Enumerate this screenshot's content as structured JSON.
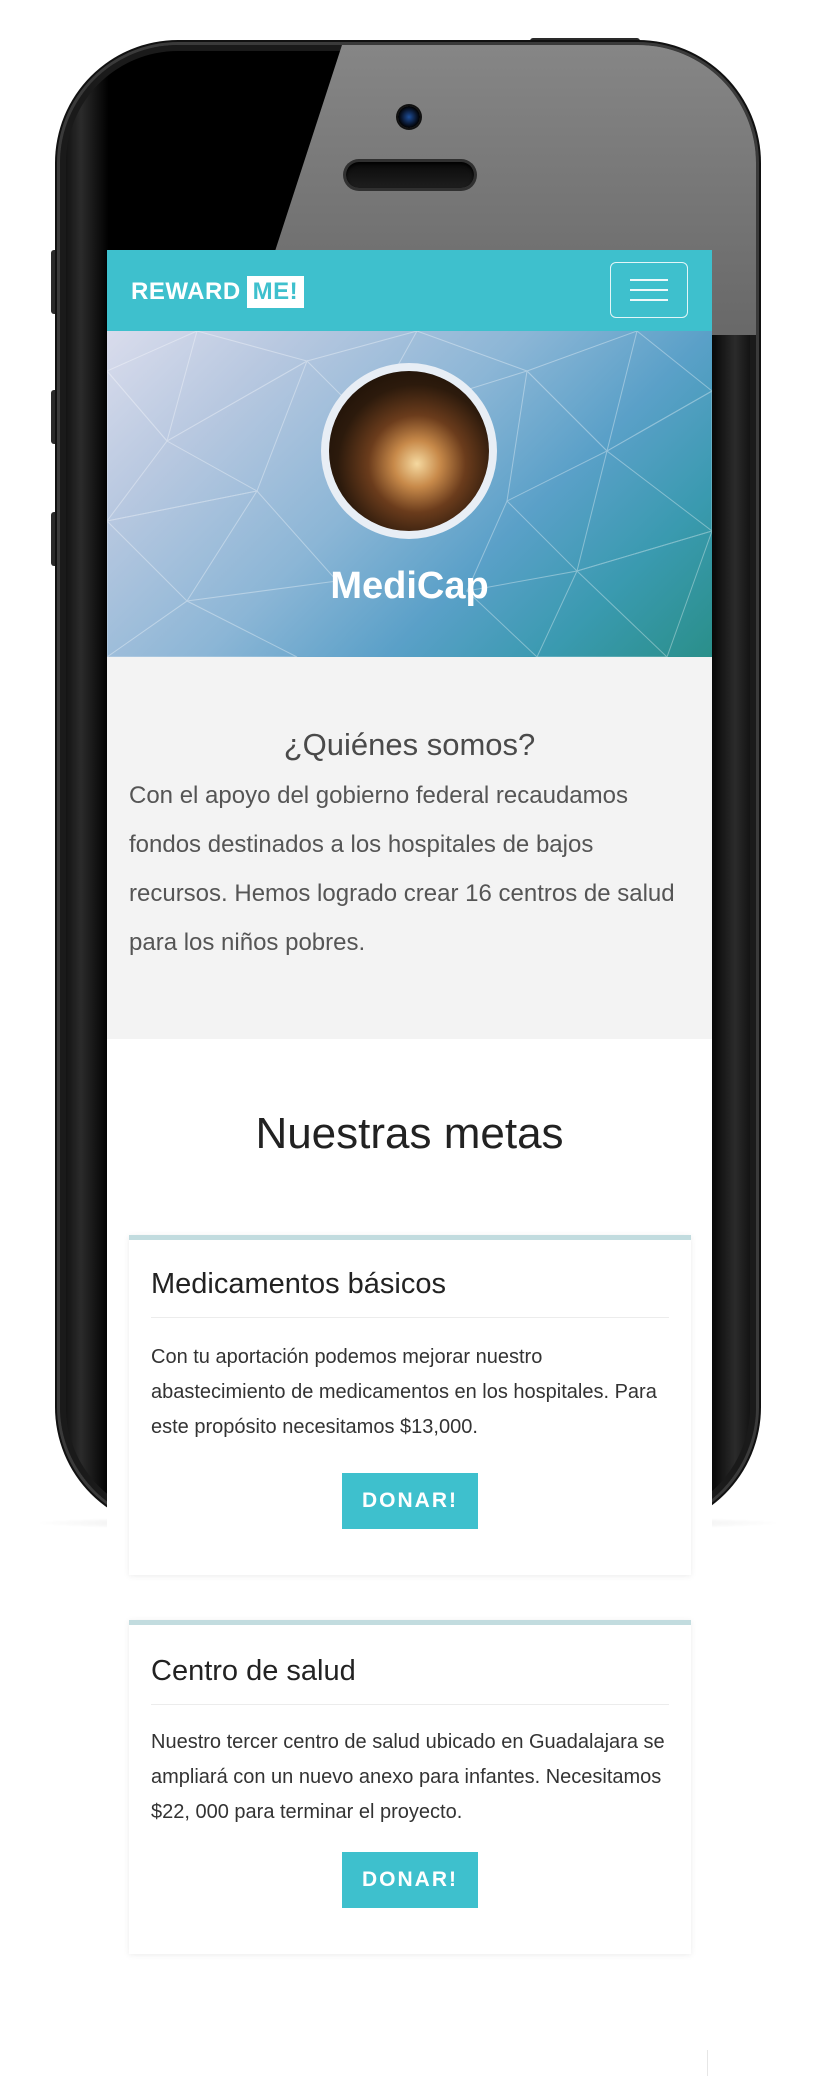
{
  "navbar": {
    "brand_text": "REWARD",
    "brand_highlight": "ME!",
    "menu_icon": "hamburger-menu-icon"
  },
  "hero": {
    "title": "MediCap",
    "avatar_icon": "organization-avatar"
  },
  "about": {
    "heading": "¿Quiénes somos?",
    "text": "Con el apoyo del gobierno federal recaudamos fondos destinados a los hospitales de bajos recursos. Hemos logrado crear 16 centros de salud para los niños pobres."
  },
  "goals": {
    "heading": "Nuestras metas",
    "items": [
      {
        "title": "Medicamentos básicos",
        "text": "Con tu aportación podemos mejorar nuestro abastecimiento de medicamentos en los hospitales. Para este propósito necesitamos $13,000.",
        "button": "DONAR!"
      },
      {
        "title": "Centro de salud",
        "text": "Nuestro tercer centro de salud ubicado en Guadalajara se ampliará con un nuevo anexo para infantes. Necesitamos $22, 000 para terminar el proyecto.",
        "button": "DONAR!"
      }
    ]
  },
  "colors": {
    "accent": "#3ec0cd",
    "card_border": "#c2dcdf",
    "about_bg": "#f3f3f3"
  }
}
